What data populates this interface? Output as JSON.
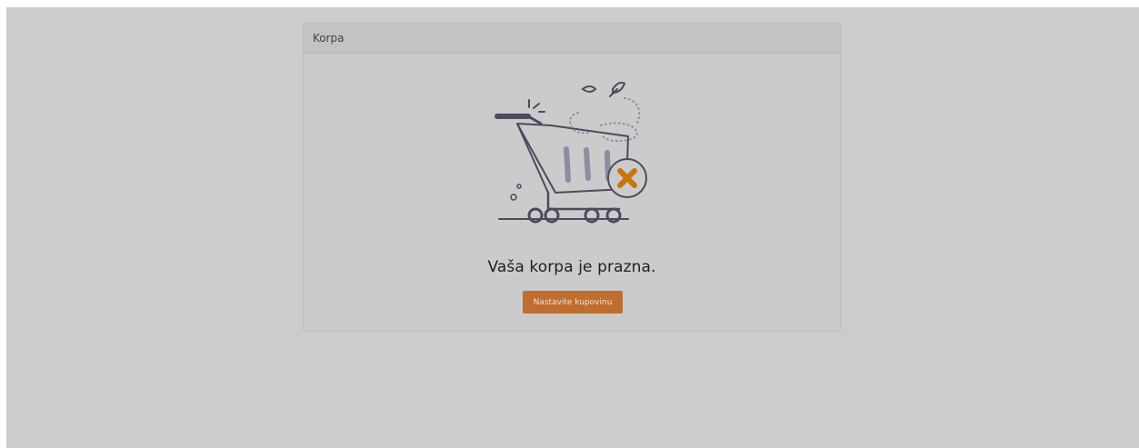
{
  "card": {
    "title": "Korpa"
  },
  "empty_state": {
    "message": "Vaša korpa je prazna.",
    "continue_label": "Nastavite kupovinu",
    "illustration": "empty-cart-icon"
  },
  "colors": {
    "overlay": "#cccccc",
    "accent": "#c06e2f",
    "icon_stroke": "#4a4c5e",
    "icon_accent": "#c8750c"
  }
}
